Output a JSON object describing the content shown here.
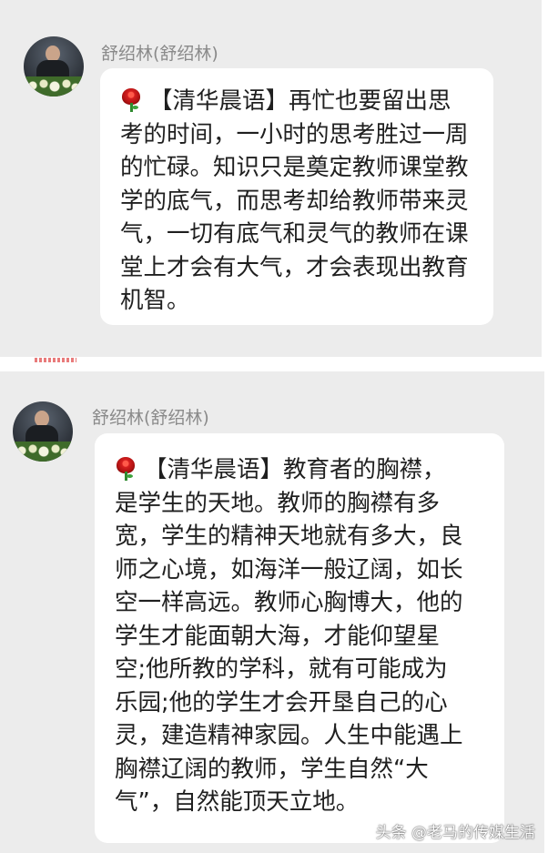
{
  "messages": [
    {
      "sender": "舒绍林(舒绍林)",
      "avatar_icon": "avatar-photo",
      "emoji_icon": "rose-icon",
      "lines": [
        "【清华晨语】再忙也要留出思",
        "考的时间，一小时的思考胜过一周",
        "的忙碌。知识只是奠定教师课堂教",
        "学的底气，而思考却给教师带来灵",
        "气，一切有底气和灵气的教师在课",
        "堂上才会有大气，才会表现出教育",
        "机智。"
      ]
    },
    {
      "sender": "舒绍林(舒绍林)",
      "avatar_icon": "avatar-photo",
      "emoji_icon": "rose-icon",
      "lines": [
        "【清华晨语】教育者的胸襟，",
        "是学生的天地。教师的胸襟有多",
        "宽，学生的精神天地就有多大，良",
        "师之心境，如海洋一般辽阔，如长",
        "空一样高远。教师心胸博大，他的",
        "学生才能面朝大海，才能仰望星",
        "空;他所教的学科，就有可能成为",
        "乐园;他的学生才会开垦自己的心",
        "灵，建造精神家园。人生中能遇上",
        "胸襟辽阔的教师，学生自然“大",
        "气”，自然能顶天立地。"
      ]
    }
  ],
  "watermark": "头条 @老马的传媒生活",
  "colors": {
    "panel_background": "#ececec",
    "bubble_background": "#ffffff",
    "sender_name": "#8a8a8a",
    "message_text": "#1f1f1f",
    "rose": "#c81818"
  }
}
